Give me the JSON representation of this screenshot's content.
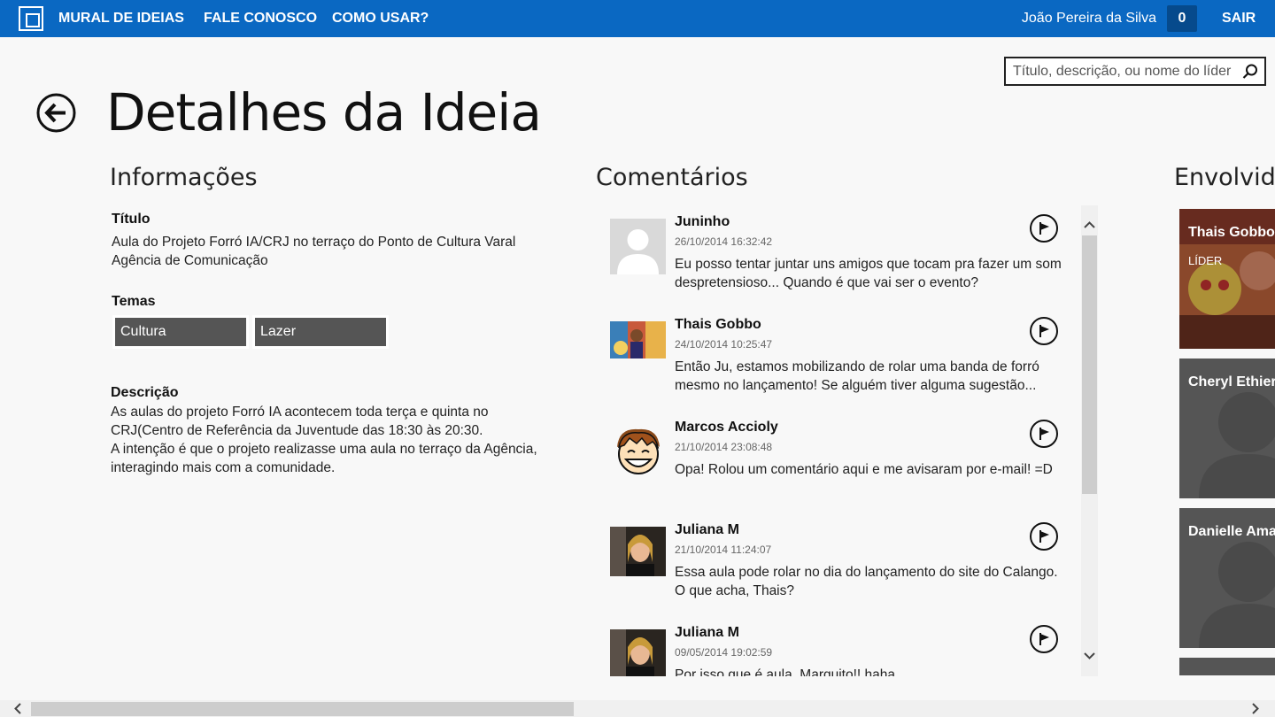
{
  "topbar": {
    "nav": [
      "MURAL DE IDEIAS",
      "FALE CONOSCO",
      "COMO USAR?"
    ],
    "user_name": "João Pereira da Silva",
    "notification_count": "0",
    "logout_label": "SAIR"
  },
  "search": {
    "placeholder": "Título, descrição, ou nome do líder"
  },
  "page": {
    "title": "Detalhes da Ideia"
  },
  "info": {
    "heading": "Informações",
    "title_label": "Título",
    "title_value": "Aula do Projeto Forró IA/CRJ no terraço do Ponto de Cultura Varal Agência de Comunicação",
    "themes_label": "Temas",
    "themes": [
      "Cultura",
      "Lazer"
    ],
    "description_label": "Descrição",
    "description_lines": [
      "As aulas do projeto Forró IA acontecem toda terça e quinta no",
      "CRJ(Centro de Referência da Juventude das 18:30 às 20:30.",
      "A intenção é que o projeto realizasse uma aula no terraço da Agência,",
      "interagindo mais com a comunidade."
    ]
  },
  "comments": {
    "heading": "Comentários",
    "items": [
      {
        "author": "Juninho",
        "date": "26/10/2014 16:32:42",
        "text": "Eu posso tentar juntar uns amigos que tocam pra fazer um som despretensioso... Quando é que vai ser o evento?",
        "avatar": "default-avatar"
      },
      {
        "author": "Thais Gobbo",
        "date": "24/10/2014 10:25:47",
        "text": "Então Ju, estamos mobilizando de rolar uma banda de forró mesmo no lançamento! Se alguém tiver alguma sugestão...",
        "avatar": "photo-avatar"
      },
      {
        "author": "Marcos Accioly",
        "date": "21/10/2014 23:08:48",
        "text": "Opa! Rolou um comentário aqui e me avisaram por e-mail! =D",
        "avatar": "cartoon-avatar"
      },
      {
        "author": "Juliana M",
        "date": "21/10/2014 11:24:07",
        "text": "Essa aula pode rolar no dia do lançamento do site do Calango. O que acha, Thais?",
        "avatar": "photo-avatar"
      },
      {
        "author": "Juliana M",
        "date": "09/05/2014 19:02:59",
        "text": "Por isso que é aula, Marquito!! haha",
        "avatar": "photo-avatar"
      }
    ]
  },
  "involved": {
    "heading": "Envolvidos",
    "people": [
      {
        "name": "Thais Gobbo",
        "role": "LÍDER"
      },
      {
        "name": "Cheryl Ethier",
        "role": ""
      },
      {
        "name": "Danielle Amar",
        "role": ""
      },
      {
        "name": "",
        "role": ""
      }
    ]
  },
  "colors": {
    "topbar": "#0a68c2",
    "tag": "#555555",
    "tile": "#555555"
  }
}
